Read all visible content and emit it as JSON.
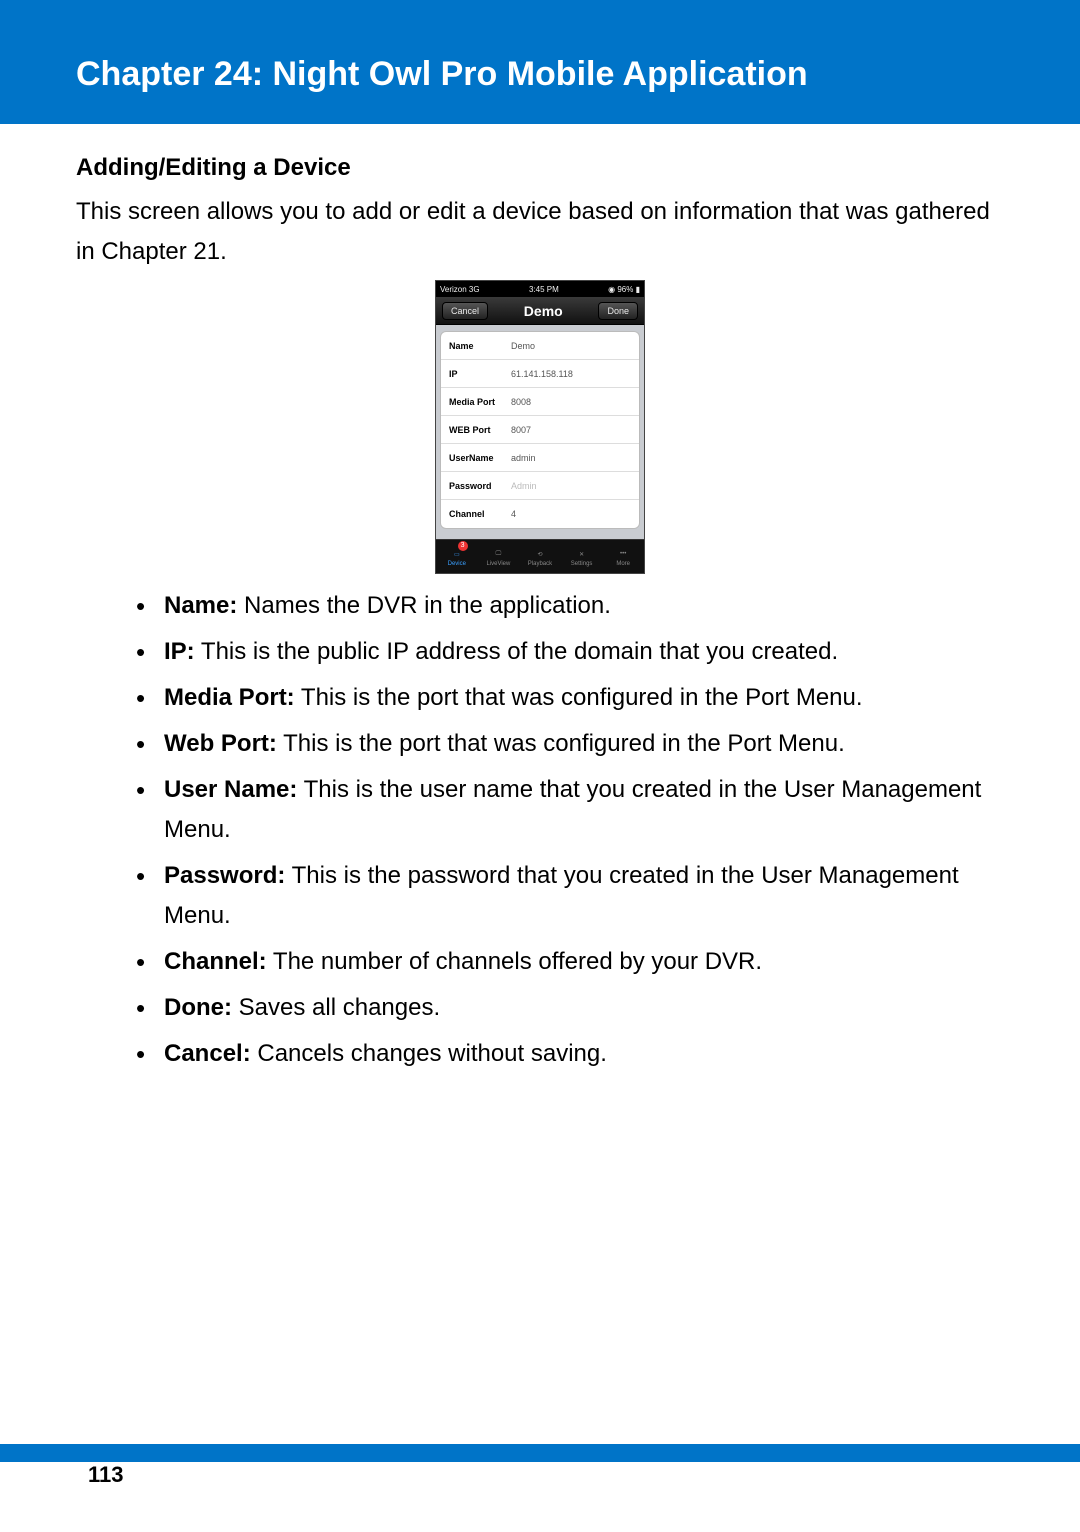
{
  "chapter_title": "Chapter 24: Night Owl Pro Mobile Application",
  "section_heading": "Adding/Editing a Device",
  "intro": "This screen allows you to add or edit a device based on information that was gathered in Chapter 21.",
  "phone": {
    "status": {
      "carrier": "Verizon  3G",
      "time": "3:45 PM",
      "battery": "96%"
    },
    "nav": {
      "cancel": "Cancel",
      "title": "Demo",
      "done": "Done"
    },
    "fields": [
      {
        "label": "Name",
        "value": "Demo",
        "placeholder": false
      },
      {
        "label": "IP",
        "value": "61.141.158.118",
        "placeholder": false
      },
      {
        "label": "Media Port",
        "value": "8008",
        "placeholder": false
      },
      {
        "label": "WEB Port",
        "value": "8007",
        "placeholder": false
      },
      {
        "label": "UserName",
        "value": "admin",
        "placeholder": false
      },
      {
        "label": "Password",
        "value": "Admin",
        "placeholder": true
      },
      {
        "label": "Channel",
        "value": "4",
        "placeholder": false
      }
    ],
    "tabs": [
      {
        "label": "Device",
        "icon": "device-icon",
        "active": true,
        "badge": "3"
      },
      {
        "label": "LiveView",
        "icon": "monitor-icon",
        "active": false
      },
      {
        "label": "Playback",
        "icon": "playback-icon",
        "active": false
      },
      {
        "label": "Settings",
        "icon": "settings-icon",
        "active": false
      },
      {
        "label": "More",
        "icon": "more-icon",
        "active": false
      }
    ]
  },
  "definitions": [
    {
      "term": "Name:",
      "desc": " Names the DVR in the application."
    },
    {
      "term": "IP:",
      "desc": " This is the public IP address of the domain that you created."
    },
    {
      "term": "Media Port:",
      "desc": " This is the port that was configured in the Port Menu."
    },
    {
      "term": "Web Port:",
      "desc": " This is the port that was configured in the Port Menu."
    },
    {
      "term": "User Name:",
      "desc": " This is the user name that you created in the User Management Menu."
    },
    {
      "term": "Password:",
      "desc": " This is the password that you created in the User Management Menu."
    },
    {
      "term": "Channel:",
      "desc": " The number of channels offered by your DVR."
    },
    {
      "term": "Done:",
      "desc": " Saves all changes."
    },
    {
      "term": "Cancel:",
      "desc": " Cancels changes without saving."
    }
  ],
  "page_number": "113"
}
